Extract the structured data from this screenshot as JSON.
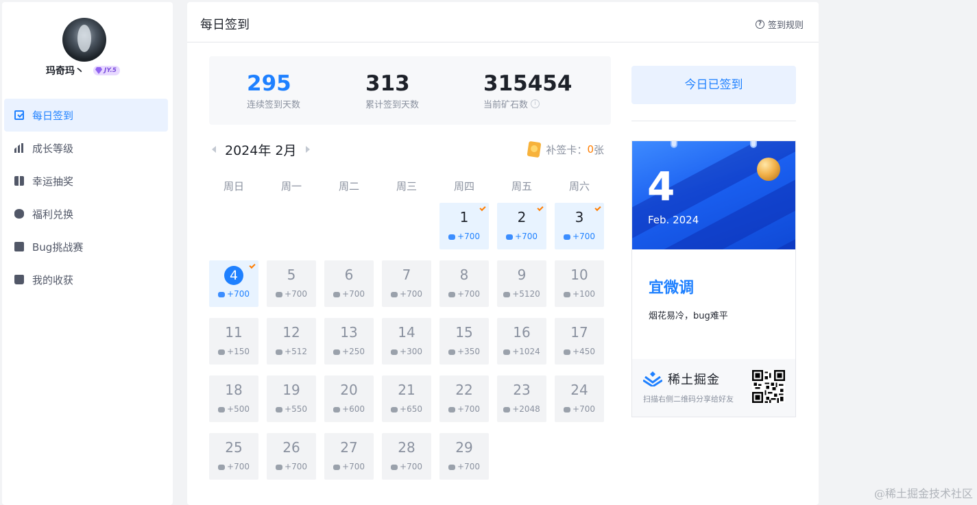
{
  "user": {
    "name": "玛奇玛丶",
    "level": "JY.5"
  },
  "sidebar": {
    "items": [
      {
        "label": "每日签到",
        "icon": "calendar-check-icon",
        "active": true
      },
      {
        "label": "成长等级",
        "icon": "bar-chart-icon"
      },
      {
        "label": "幸运抽奖",
        "icon": "gift-icon"
      },
      {
        "label": "福利兑换",
        "icon": "coin-stack-icon"
      },
      {
        "label": "Bug挑战赛",
        "icon": "bug-icon"
      },
      {
        "label": "我的收获",
        "icon": "bag-icon"
      }
    ]
  },
  "header": {
    "title": "每日签到",
    "rules_label": "签到规则"
  },
  "stats": {
    "streak": {
      "value": "295",
      "label": "连续签到天数"
    },
    "total": {
      "value": "313",
      "label": "累计签到天数"
    },
    "ore": {
      "value": "315454",
      "label": "当前矿石数"
    }
  },
  "calendar": {
    "month_label": "2024年 2月",
    "makeup_label": "补签卡：",
    "makeup_count": "0",
    "makeup_unit": "张",
    "weekdays": [
      "周日",
      "周一",
      "周二",
      "周三",
      "周四",
      "周五",
      "周六"
    ],
    "first_weekday": 4,
    "today": 4,
    "days": [
      {
        "day": "1",
        "points": "+700",
        "signed": true
      },
      {
        "day": "2",
        "points": "+700",
        "signed": true
      },
      {
        "day": "3",
        "points": "+700",
        "signed": true
      },
      {
        "day": "4",
        "points": "+700",
        "signed": true
      },
      {
        "day": "5",
        "points": "+700"
      },
      {
        "day": "6",
        "points": "+700"
      },
      {
        "day": "7",
        "points": "+700"
      },
      {
        "day": "8",
        "points": "+700"
      },
      {
        "day": "9",
        "points": "+5120"
      },
      {
        "day": "10",
        "points": "+100"
      },
      {
        "day": "11",
        "points": "+150"
      },
      {
        "day": "12",
        "points": "+512"
      },
      {
        "day": "13",
        "points": "+250"
      },
      {
        "day": "14",
        "points": "+300"
      },
      {
        "day": "15",
        "points": "+350"
      },
      {
        "day": "16",
        "points": "+1024"
      },
      {
        "day": "17",
        "points": "+450"
      },
      {
        "day": "18",
        "points": "+500"
      },
      {
        "day": "19",
        "points": "+550"
      },
      {
        "day": "20",
        "points": "+600"
      },
      {
        "day": "21",
        "points": "+650"
      },
      {
        "day": "22",
        "points": "+700"
      },
      {
        "day": "23",
        "points": "+2048"
      },
      {
        "day": "24",
        "points": "+700"
      },
      {
        "day": "25",
        "points": "+700"
      },
      {
        "day": "26",
        "points": "+700"
      },
      {
        "day": "27",
        "points": "+700"
      },
      {
        "day": "28",
        "points": "+700"
      },
      {
        "day": "29",
        "points": "+700"
      }
    ]
  },
  "signin_button": "今日已签到",
  "day_card": {
    "day": "4",
    "date": "Feb. 2024",
    "fortune": "宜微调",
    "quote": "烟花易冷，bug难平",
    "brand": "稀土掘金",
    "tip": "扫描右侧二维码分享给好友"
  },
  "watermark": "@稀土掘金技术社区",
  "colors": {
    "accent": "#1e80ff",
    "check": "#ff7d00",
    "signed_bg": "#e8f3ff"
  }
}
